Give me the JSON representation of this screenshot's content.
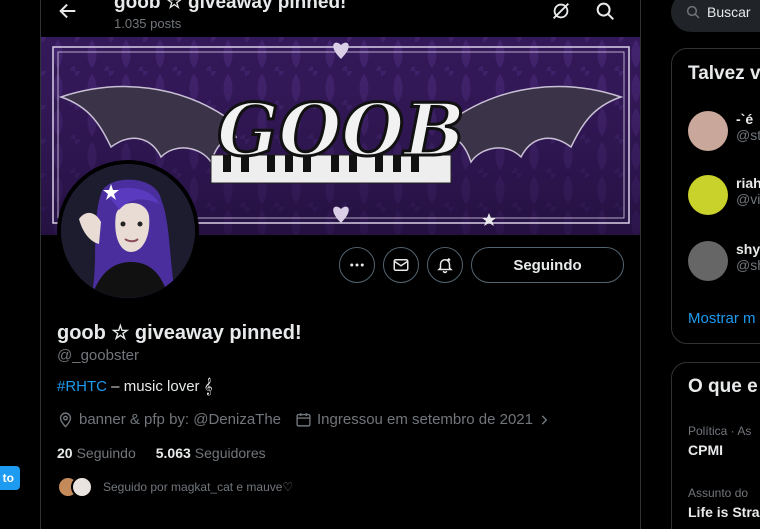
{
  "header": {
    "title": "goob ☆ giveaway pinned!",
    "posts_count": "1.035 posts"
  },
  "banner": {
    "logo_text": "GOOB"
  },
  "profile": {
    "display_name": "goob ☆ giveaway pinned!",
    "handle": "@_goobster",
    "bio_tag": "#RHTC",
    "bio_rest": " – music lover 𝄞",
    "location": "banner & pfp by: @DenizaThe",
    "joined": "Ingressou em setembro de 2021",
    "following_count": "20",
    "following_label": "Seguindo",
    "followers_count": "5.063",
    "followers_label": "Seguidores",
    "followed_by": "Seguido por magkat_cat e mauve♡"
  },
  "actions": {
    "follow_label": "Seguindo",
    "more_icon": "more-icon",
    "message_icon": "mail-icon",
    "notify_icon": "bell-icon"
  },
  "sidebar": {
    "search_placeholder": "Buscar",
    "who_to_follow_title": "Talvez v",
    "suggestions": [
      {
        "name": "-`é",
        "handle": "@st"
      },
      {
        "name": "riah",
        "handle": "@vi"
      },
      {
        "name": "shy",
        "handle": "@sh"
      }
    ],
    "show_more": "Mostrar m",
    "trends_title": "O que e",
    "trends": [
      {
        "category": "Política · As",
        "name": "CPMI"
      },
      {
        "category": "Assunto do",
        "name": "Life is Stra"
      }
    ]
  },
  "left": {
    "cut_button": "to"
  },
  "colors": {
    "accent": "#1d9bf0",
    "background": "#000000",
    "muted": "#71767b",
    "banner_purple": "#3a1f5c"
  }
}
